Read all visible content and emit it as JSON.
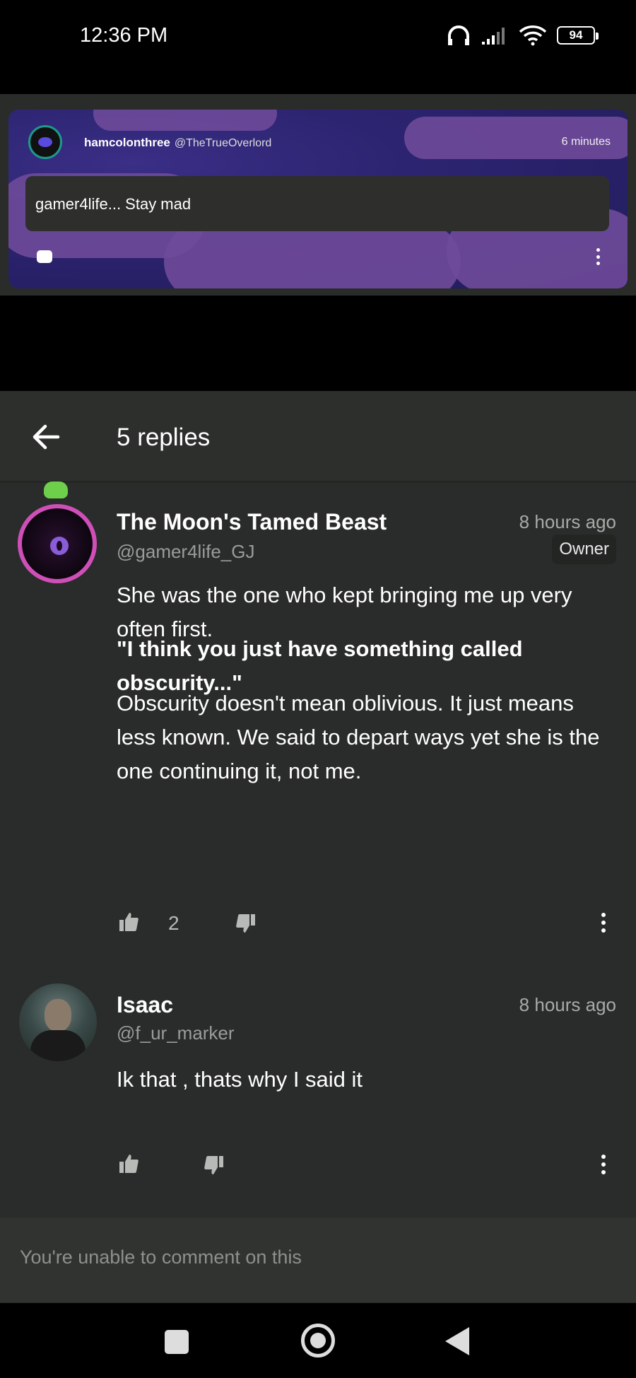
{
  "status_bar": {
    "time": "12:36 PM",
    "battery": "94"
  },
  "preview": {
    "author": "hamcolonthree",
    "handle": "@TheTrueOverlord",
    "time": "6 minutes",
    "text": "gamer4life... Stay mad"
  },
  "sheet": {
    "title": "5 replies"
  },
  "replies": [
    {
      "author": "The Moon's Tamed Beast",
      "handle": "@gamer4life_GJ",
      "time": "8 hours ago",
      "badge": "Owner",
      "paragraph1": "She was the one who kept bringing me up very often first.",
      "paragraph2": "\"I think you just have something called obscurity...\"",
      "paragraph3": "Obscurity doesn't mean oblivious. It just means less known. We said to depart ways yet she is the one continuing it, not me.",
      "likes": "2"
    },
    {
      "author": "Isaac",
      "handle": "@f_ur_marker",
      "time": "8 hours ago",
      "paragraph1": "Ik that , thats why I said it"
    }
  ],
  "footer": {
    "text": "You're unable to comment on this"
  },
  "colors": {
    "background": "#2a2c2b",
    "owner_badge": "#232523",
    "avatar_ring": "#cf4fb8"
  }
}
